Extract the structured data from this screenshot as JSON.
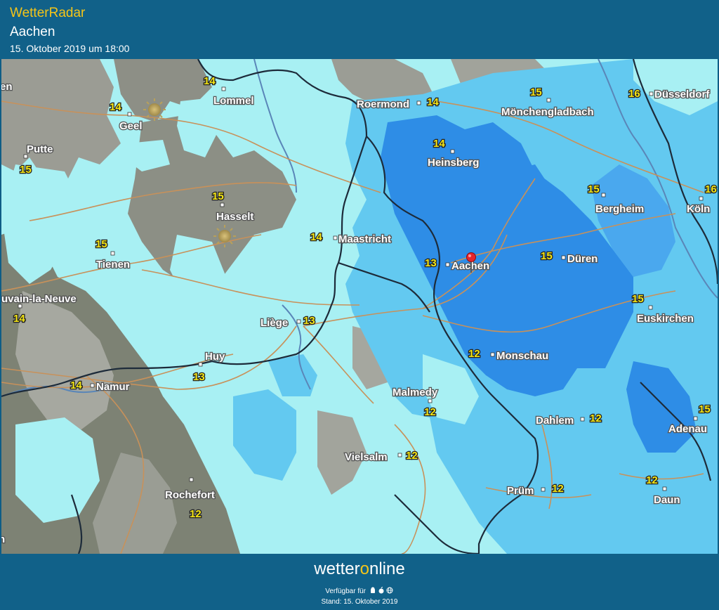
{
  "header": {
    "app_name": "WetterRadar",
    "location": "Aachen",
    "datetime": "15. Oktober 2019 um 18:00"
  },
  "footer": {
    "logo_pre": "wetter",
    "logo_o": "o",
    "logo_post": "nline",
    "available_on": "Verfügbar für",
    "status": "Stand: 15. Oktober 2019"
  },
  "colors": {
    "brand_accent": "#f5c518",
    "header_bg": "#116189",
    "temp_label": "#f5e615",
    "precip_light": "#a8f0f3",
    "precip_medium": "#63c9f0",
    "precip_heavy": "#2e8de6",
    "marker": "#e8242a"
  },
  "icons": {
    "sun": "sun-icon",
    "location_marker": "location-pin-icon",
    "platforms": [
      "android-icon",
      "apple-icon",
      "web-icon"
    ]
  },
  "map": {
    "cities": [
      {
        "name": "Lommel",
        "temp": "14"
      },
      {
        "name": "Geel",
        "temp": "14"
      },
      {
        "name": "Putte",
        "temp": "15"
      },
      {
        "name": "Hasselt",
        "temp": "15"
      },
      {
        "name": "Tienen",
        "temp": "15"
      },
      {
        "name": "uvain-la-Neuve",
        "temp": "14"
      },
      {
        "name": "Namur",
        "temp": "14"
      },
      {
        "name": "Huy",
        "temp": "13"
      },
      {
        "name": "Liège",
        "temp": "13"
      },
      {
        "name": "Maastricht",
        "temp": "14"
      },
      {
        "name": "Roermond",
        "temp": "14"
      },
      {
        "name": "Heinsberg",
        "temp": "14"
      },
      {
        "name": "Mönchengladbach",
        "temp": "15"
      },
      {
        "name": "Düsseldorf",
        "temp": "16"
      },
      {
        "name": "Köln",
        "temp": "16"
      },
      {
        "name": "Bergheim",
        "temp": "15"
      },
      {
        "name": "Düren",
        "temp": "15"
      },
      {
        "name": "Aachen",
        "temp": "13"
      },
      {
        "name": "Euskirchen",
        "temp": "15"
      },
      {
        "name": "Monschau",
        "temp": "12"
      },
      {
        "name": "Malmedy",
        "temp": "12"
      },
      {
        "name": "Dahlem",
        "temp": "12"
      },
      {
        "name": "Adenau",
        "temp": "15"
      },
      {
        "name": "Vielsalm",
        "temp": "12"
      },
      {
        "name": "Prüm",
        "temp": "12"
      },
      {
        "name": "Daun",
        "temp": "12"
      },
      {
        "name": "Rochefort",
        "temp": "12"
      }
    ],
    "edge_labels": [
      "en",
      "n"
    ]
  }
}
